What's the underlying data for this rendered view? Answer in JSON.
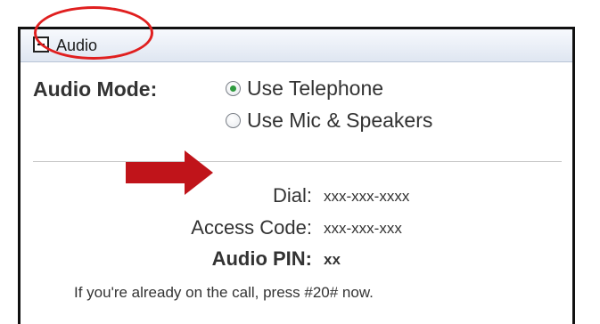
{
  "header": {
    "title": "Audio",
    "collapse_icon": "minus-box-icon"
  },
  "audio_mode": {
    "label": "Audio Mode:",
    "options": [
      {
        "label": "Use Telephone",
        "checked": true
      },
      {
        "label": "Use Mic & Speakers",
        "checked": false
      }
    ]
  },
  "dial_info": {
    "dial_label": "Dial:",
    "dial_value": "xxx-xxx-xxxx",
    "access_code_label": "Access Code:",
    "access_code_value": "xxx-xxx-xxx",
    "pin_label": "Audio PIN:",
    "pin_value": "xx"
  },
  "note": "If you're already on the call, press #20# now.",
  "annotations": {
    "arrow_color": "#c0141a",
    "circle_color": "#e01f1f",
    "radio_selected_color": "#2f9a3f"
  }
}
